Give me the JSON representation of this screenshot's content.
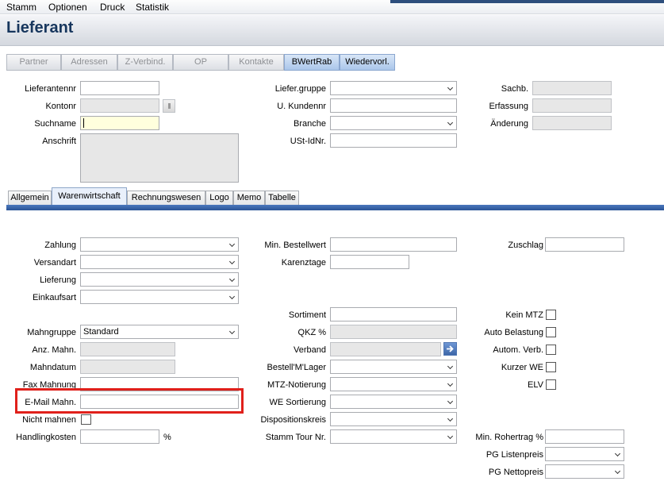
{
  "menu": [
    "Stamm",
    "Optionen",
    "Druck",
    "Statistik"
  ],
  "window": {
    "title": "Lieferant"
  },
  "top_tabs": [
    {
      "label": "Partner",
      "active": false
    },
    {
      "label": "Adressen",
      "active": false
    },
    {
      "label": "Z-Verbind.",
      "active": false
    },
    {
      "label": "OP",
      "active": false
    },
    {
      "label": "Kontakte",
      "active": false
    },
    {
      "label": "BWertRab",
      "active": true
    },
    {
      "label": "Wiedervorl.",
      "active": true
    }
  ],
  "header": {
    "lieferantennr": {
      "label": "Lieferantennr",
      "value": ""
    },
    "kontonr": {
      "label": "Kontonr",
      "value": ""
    },
    "suchname": {
      "label": "Suchname",
      "value": ""
    },
    "anschrift": {
      "label": "Anschrift",
      "value": ""
    },
    "liefer_gruppe": {
      "label": "Liefer.gruppe",
      "value": ""
    },
    "u_kundennr": {
      "label": "U. Kundennr",
      "value": ""
    },
    "branche": {
      "label": "Branche",
      "value": ""
    },
    "ust_idnr": {
      "label": "USt-IdNr.",
      "value": ""
    },
    "sachb": {
      "label": "Sachb.",
      "value": ""
    },
    "erfassung": {
      "label": "Erfassung",
      "value": ""
    },
    "aenderung": {
      "label": "Änderung",
      "value": ""
    }
  },
  "sub_tabs": [
    {
      "label": "Allgemein",
      "active": false
    },
    {
      "label": "Warenwirtschaft",
      "active": true
    },
    {
      "label": "Rechnungswesen",
      "active": false
    },
    {
      "label": "Logo",
      "active": false
    },
    {
      "label": "Memo",
      "active": false
    },
    {
      "label": "Tabelle",
      "active": false
    }
  ],
  "form": {
    "zahlung": {
      "label": "Zahlung",
      "value": ""
    },
    "versandart": {
      "label": "Versandart",
      "value": ""
    },
    "lieferung": {
      "label": "Lieferung",
      "value": ""
    },
    "einkaufsart": {
      "label": "Einkaufsart",
      "value": ""
    },
    "mahngruppe": {
      "label": "Mahngruppe",
      "value": "Standard"
    },
    "anz_mahn": {
      "label": "Anz. Mahn.",
      "value": ""
    },
    "mahndatum": {
      "label": "Mahndatum",
      "value": ""
    },
    "fax_mahnung": {
      "label": "Fax Mahnung",
      "value": ""
    },
    "email_mahn": {
      "label": "E-Mail Mahn.",
      "value": ""
    },
    "nicht_mahnen": {
      "label": "Nicht mahnen",
      "checked": false
    },
    "handlingkosten": {
      "label": "Handlingkosten",
      "value": "",
      "unit": "%"
    },
    "min_bestellwert": {
      "label": "Min. Bestellwert",
      "value": ""
    },
    "karenztage": {
      "label": "Karenztage",
      "value": ""
    },
    "sortiment": {
      "label": "Sortiment",
      "value": ""
    },
    "qkz": {
      "label": "QKZ %",
      "value": ""
    },
    "verband": {
      "label": "Verband",
      "value": ""
    },
    "bestell_lager": {
      "label": "Bestell'M'Lager",
      "value": ""
    },
    "mtz_notierung": {
      "label": "MTZ-Notierung",
      "value": ""
    },
    "we_sortierung": {
      "label": "WE Sortierung",
      "value": ""
    },
    "dispositionskreis": {
      "label": "Dispositionskreis",
      "value": ""
    },
    "stamm_tour_nr": {
      "label": "Stamm Tour Nr.",
      "value": ""
    },
    "zuschlag": {
      "label": "Zuschlag",
      "value": ""
    },
    "kein_mtz": {
      "label": "Kein MTZ",
      "checked": false
    },
    "auto_belastung": {
      "label": "Auto Belastung",
      "checked": false
    },
    "autom_verb": {
      "label": "Autom. Verb.",
      "checked": false
    },
    "kurzer_we": {
      "label": "Kurzer WE",
      "checked": false
    },
    "elv": {
      "label": "ELV",
      "checked": false
    },
    "min_rohertrag": {
      "label": "Min. Rohertrag %",
      "value": ""
    },
    "pg_listenpreis": {
      "label": "PG Listenpreis",
      "value": ""
    },
    "pg_nettopreis": {
      "label": "PG Nettopreis",
      "value": ""
    }
  },
  "colors": {
    "title": "#17365d",
    "tab_rule": "#2c5597",
    "highlight": "#e0201b",
    "required_field": "#ffffdd"
  }
}
